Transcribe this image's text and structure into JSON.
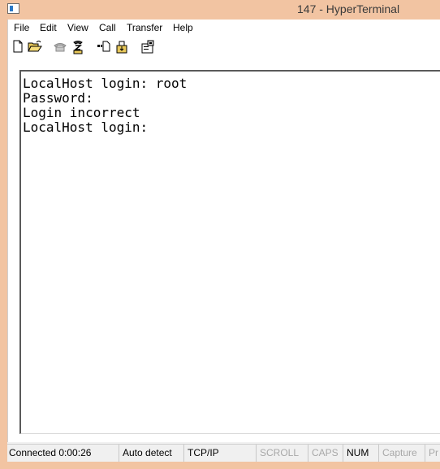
{
  "window": {
    "title": "147 - HyperTerminal",
    "icon": "hyperterminal-app-icon"
  },
  "menu": {
    "items": [
      "File",
      "Edit",
      "View",
      "Call",
      "Transfer",
      "Help"
    ]
  },
  "toolbar": {
    "buttons": [
      {
        "name": "new-icon"
      },
      {
        "name": "open-icon"
      },
      {
        "name": "connect-phone-icon"
      },
      {
        "name": "disconnect-icon"
      },
      {
        "name": "send-file-icon"
      },
      {
        "name": "receive-file-icon"
      },
      {
        "name": "properties-icon"
      }
    ]
  },
  "terminal": {
    "lines": [
      "LocalHost login: root",
      "Password:",
      "Login incorrect",
      "LocalHost login:"
    ]
  },
  "status": {
    "connected": "Connected 0:00:26",
    "detect": "Auto detect",
    "protocol": "TCP/IP",
    "scroll": "SCROLL",
    "caps": "CAPS",
    "num": "NUM",
    "capture": "Capture",
    "print": "Pr"
  },
  "colors": {
    "titlebar": "#f2c4a2",
    "terminal_bg": "#ffffff",
    "statusbar_bg": "#f0f0f0"
  }
}
